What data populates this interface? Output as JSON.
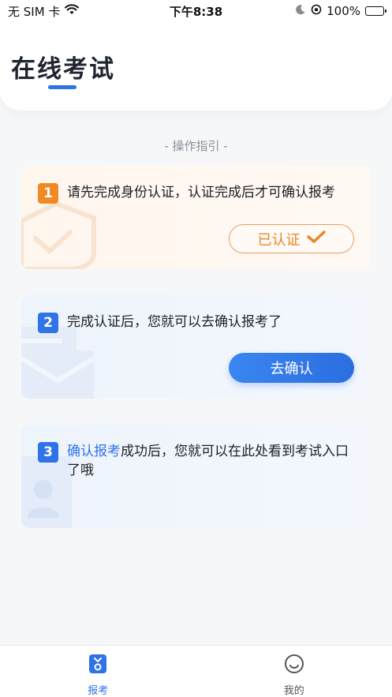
{
  "status_bar": {
    "carrier": "无 SIM 卡",
    "time": "下午8:38",
    "battery": "100%"
  },
  "header": {
    "title": "在线考试"
  },
  "guide_label": "- 操作指引 -",
  "steps": [
    {
      "number": "1",
      "text": "请先完成身份认证，认证完成后才可确认报考",
      "button_label": "已认证"
    },
    {
      "number": "2",
      "text": "完成认证后，您就可以去确认报考了",
      "button_label": "去确认"
    },
    {
      "number": "3",
      "link_text": "确认报考",
      "text": "成功后，您就可以在此处看到考试入口了哦"
    }
  ],
  "tab_bar": {
    "tabs": [
      {
        "label": "报考",
        "icon": "exam-icon",
        "active": true
      },
      {
        "label": "我的",
        "icon": "smile-icon",
        "active": false
      }
    ]
  },
  "colors": {
    "accent": "#2f73e8",
    "orange": "#f08a24"
  }
}
